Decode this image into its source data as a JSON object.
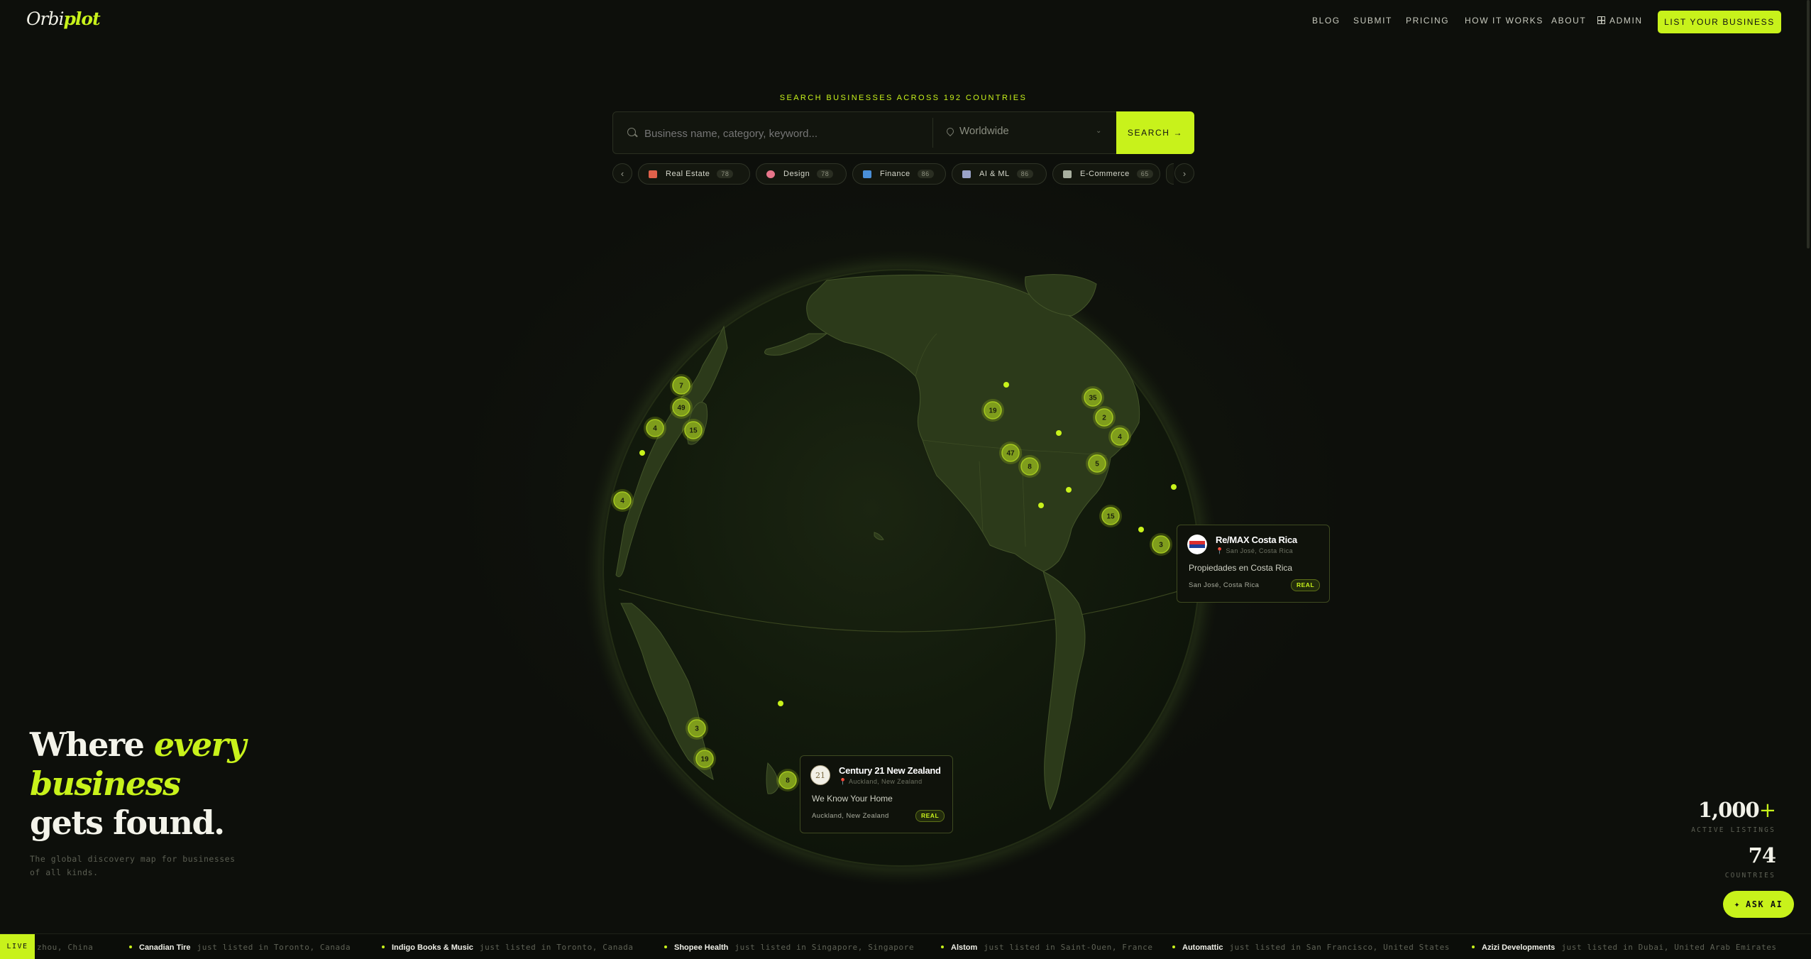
{
  "brand": {
    "logo_part1": "Orbi",
    "logo_part2": "plot"
  },
  "nav": {
    "items": [
      "BLOG",
      "SUBMIT",
      "PRICING",
      "HOW IT WORKS",
      "ABOUT",
      "ADMIN"
    ],
    "cta": "LIST YOUR BUSINESS"
  },
  "search": {
    "kicker": "SEARCH BUSINESSES ACROSS 192 COUNTRIES",
    "placeholder": "Business name, category, keyword...",
    "location": "Worldwide",
    "button": "SEARCH →"
  },
  "categories": [
    {
      "label": "Real Estate",
      "count": "78",
      "icon": "house-icon",
      "color": "#e0604a"
    },
    {
      "label": "Design",
      "count": "78",
      "icon": "palette-icon",
      "color": "#e7758a"
    },
    {
      "label": "Finance",
      "count": "86",
      "icon": "chart-icon",
      "color": "#4a8fd8"
    },
    {
      "label": "AI & ML",
      "count": "86",
      "icon": "robot-icon",
      "color": "#9aa3c8"
    },
    {
      "label": "E-Commerce",
      "count": "65",
      "icon": "cart-icon",
      "color": "#a9b0a0"
    }
  ],
  "markers": [
    "7",
    "49",
    "4",
    "15",
    "4",
    "19",
    "35",
    "2",
    "4",
    "47",
    "8",
    "5",
    "15",
    "3",
    "3",
    "19",
    "8"
  ],
  "popups": [
    {
      "name": "Re/MAX Costa Rica",
      "location": "San José, Costa Rica",
      "tagline": "Propiedades en Costa Rica",
      "bottom": "San José, Costa Rica",
      "badge": "REAL"
    },
    {
      "name": "Century 21 New Zealand",
      "location": "Auckland, New Zealand",
      "tagline": "We Know Your Home",
      "bottom": "Auckland, New Zealand",
      "badge": "REAL",
      "logo_text": "21"
    }
  ],
  "hero": {
    "line1": "Where ",
    "line1_em": "every",
    "line2_em": "business",
    "line3": "gets found.",
    "subtitle": "The global discovery map for businesses of all kinds."
  },
  "stats": [
    {
      "number": "1,000",
      "suffix": "+",
      "label": "ACTIVE LISTINGS"
    },
    {
      "number": "74",
      "suffix": "",
      "label": "COUNTRIES"
    }
  ],
  "ask_ai": "ASK AI",
  "ticker": {
    "live": "LIVE",
    "lead": "zhou, China",
    "items": [
      {
        "name": "Canadian Tire",
        "text": "just listed in Toronto, Canada"
      },
      {
        "name": "Indigo Books & Music",
        "text": "just listed in Toronto, Canada"
      },
      {
        "name": "Shopee Health",
        "text": "just listed in Singapore, Singapore"
      },
      {
        "name": "Alstom",
        "text": "just listed in Saint-Ouen, France"
      },
      {
        "name": "Automattic",
        "text": "just listed in San Francisco, United States"
      },
      {
        "name": "Azizi Developments",
        "text": "just listed in Dubai, United Arab Emirates"
      }
    ]
  },
  "colors": {
    "accent": "#c8f21b",
    "background": "#0d0f0b"
  }
}
